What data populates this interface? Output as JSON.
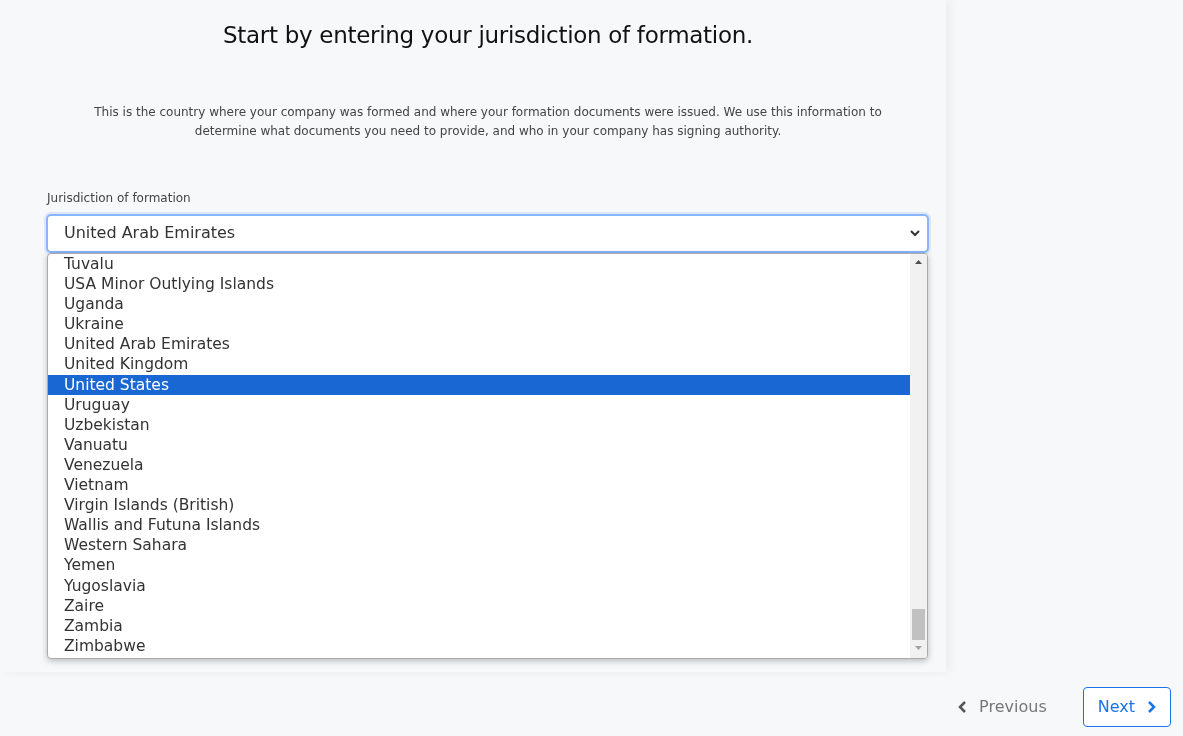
{
  "heading": "Start by entering your jurisdiction of formation.",
  "description": "This is the country where your company was formed and where your formation documents were issued. We use this information to determine what documents you need to provide, and who in your company has signing authority.",
  "field": {
    "label": "Jurisdiction of formation",
    "value": "United Arab Emirates",
    "expanded": true
  },
  "options": [
    {
      "label": "Tuvalu",
      "selected": false
    },
    {
      "label": "USA Minor Outlying Islands",
      "selected": false
    },
    {
      "label": "Uganda",
      "selected": false
    },
    {
      "label": "Ukraine",
      "selected": false
    },
    {
      "label": "United Arab Emirates",
      "selected": false
    },
    {
      "label": "United Kingdom",
      "selected": false
    },
    {
      "label": "United States",
      "selected": true
    },
    {
      "label": "Uruguay",
      "selected": false
    },
    {
      "label": "Uzbekistan",
      "selected": false
    },
    {
      "label": "Vanuatu",
      "selected": false
    },
    {
      "label": "Venezuela",
      "selected": false
    },
    {
      "label": "Vietnam",
      "selected": false
    },
    {
      "label": "Virgin Islands (British)",
      "selected": false
    },
    {
      "label": "Wallis and Futuna Islands",
      "selected": false
    },
    {
      "label": "Western Sahara",
      "selected": false
    },
    {
      "label": "Yemen",
      "selected": false
    },
    {
      "label": "Yugoslavia",
      "selected": false
    },
    {
      "label": "Zaire",
      "selected": false
    },
    {
      "label": "Zambia",
      "selected": false
    },
    {
      "label": "Zimbabwe",
      "selected": false
    }
  ],
  "buttons": [
    {
      "label": "Previous",
      "kind": "back"
    },
    {
      "label": "Next",
      "kind": "forward"
    }
  ]
}
